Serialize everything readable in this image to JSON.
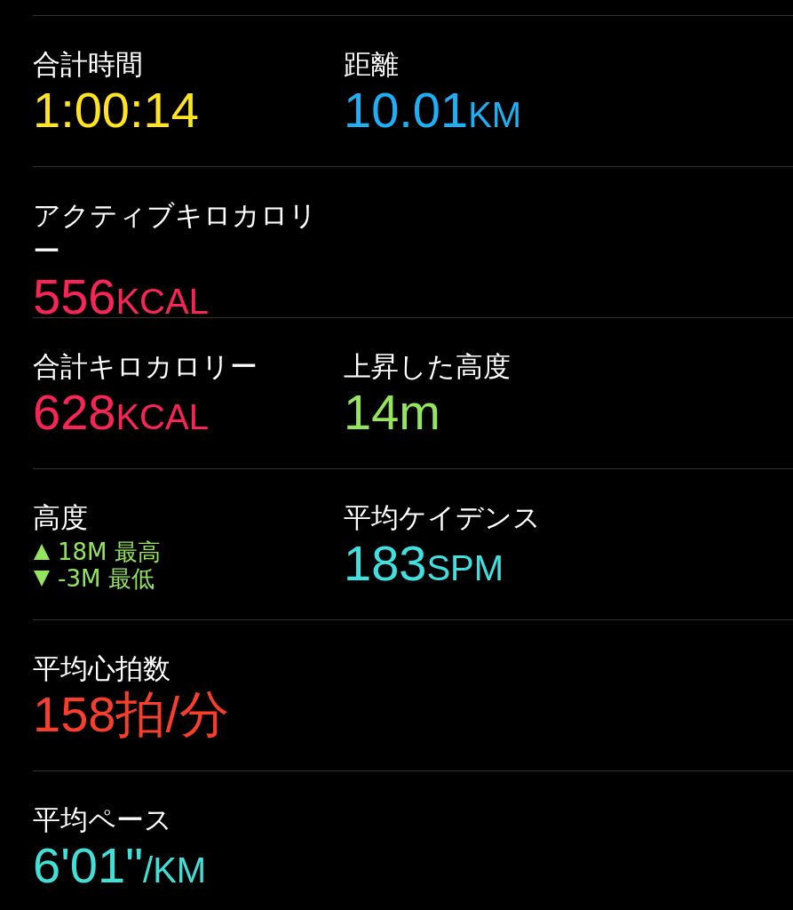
{
  "rows": [
    {
      "cells": [
        {
          "kind": "value",
          "label": "合計時間",
          "value": "1:00:14",
          "color": "#ffe41e"
        },
        {
          "kind": "value",
          "label": "距離",
          "value": "10.01",
          "unit": "KM",
          "color": "#1eb0f4"
        }
      ]
    },
    {
      "cells": [
        {
          "kind": "value",
          "label": "アクティブキロカロリー",
          "value": "556",
          "unit": "KCAL",
          "color": "#fa2456"
        }
      ]
    },
    {
      "cells": [
        {
          "kind": "value",
          "label": "合計キロカロリー",
          "value": "628",
          "unit": "KCAL",
          "color": "#fa2456"
        },
        {
          "kind": "value",
          "label": "上昇した高度",
          "value": "14m",
          "color": "#94e45e"
        }
      ]
    },
    {
      "cells": [
        {
          "kind": "range",
          "label": "高度",
          "color": "#94e45e",
          "items": [
            {
              "kind": "up",
              "text": "18M 最高"
            },
            {
              "kind": "down",
              "text": "-3M 最低"
            }
          ]
        },
        {
          "kind": "value",
          "label": "平均ケイデンス",
          "value": "183",
          "unit": "SPM",
          "color": "#40e0e0"
        }
      ]
    },
    {
      "cells": [
        {
          "kind": "value",
          "label": "平均心拍数",
          "value": "158拍/分",
          "color": "#fa3e2a"
        }
      ]
    },
    {
      "cells": [
        {
          "kind": "value",
          "label": "平均ペース",
          "value": "6'01\"",
          "unit": "/KM",
          "color": "#40e0d8"
        }
      ]
    }
  ]
}
